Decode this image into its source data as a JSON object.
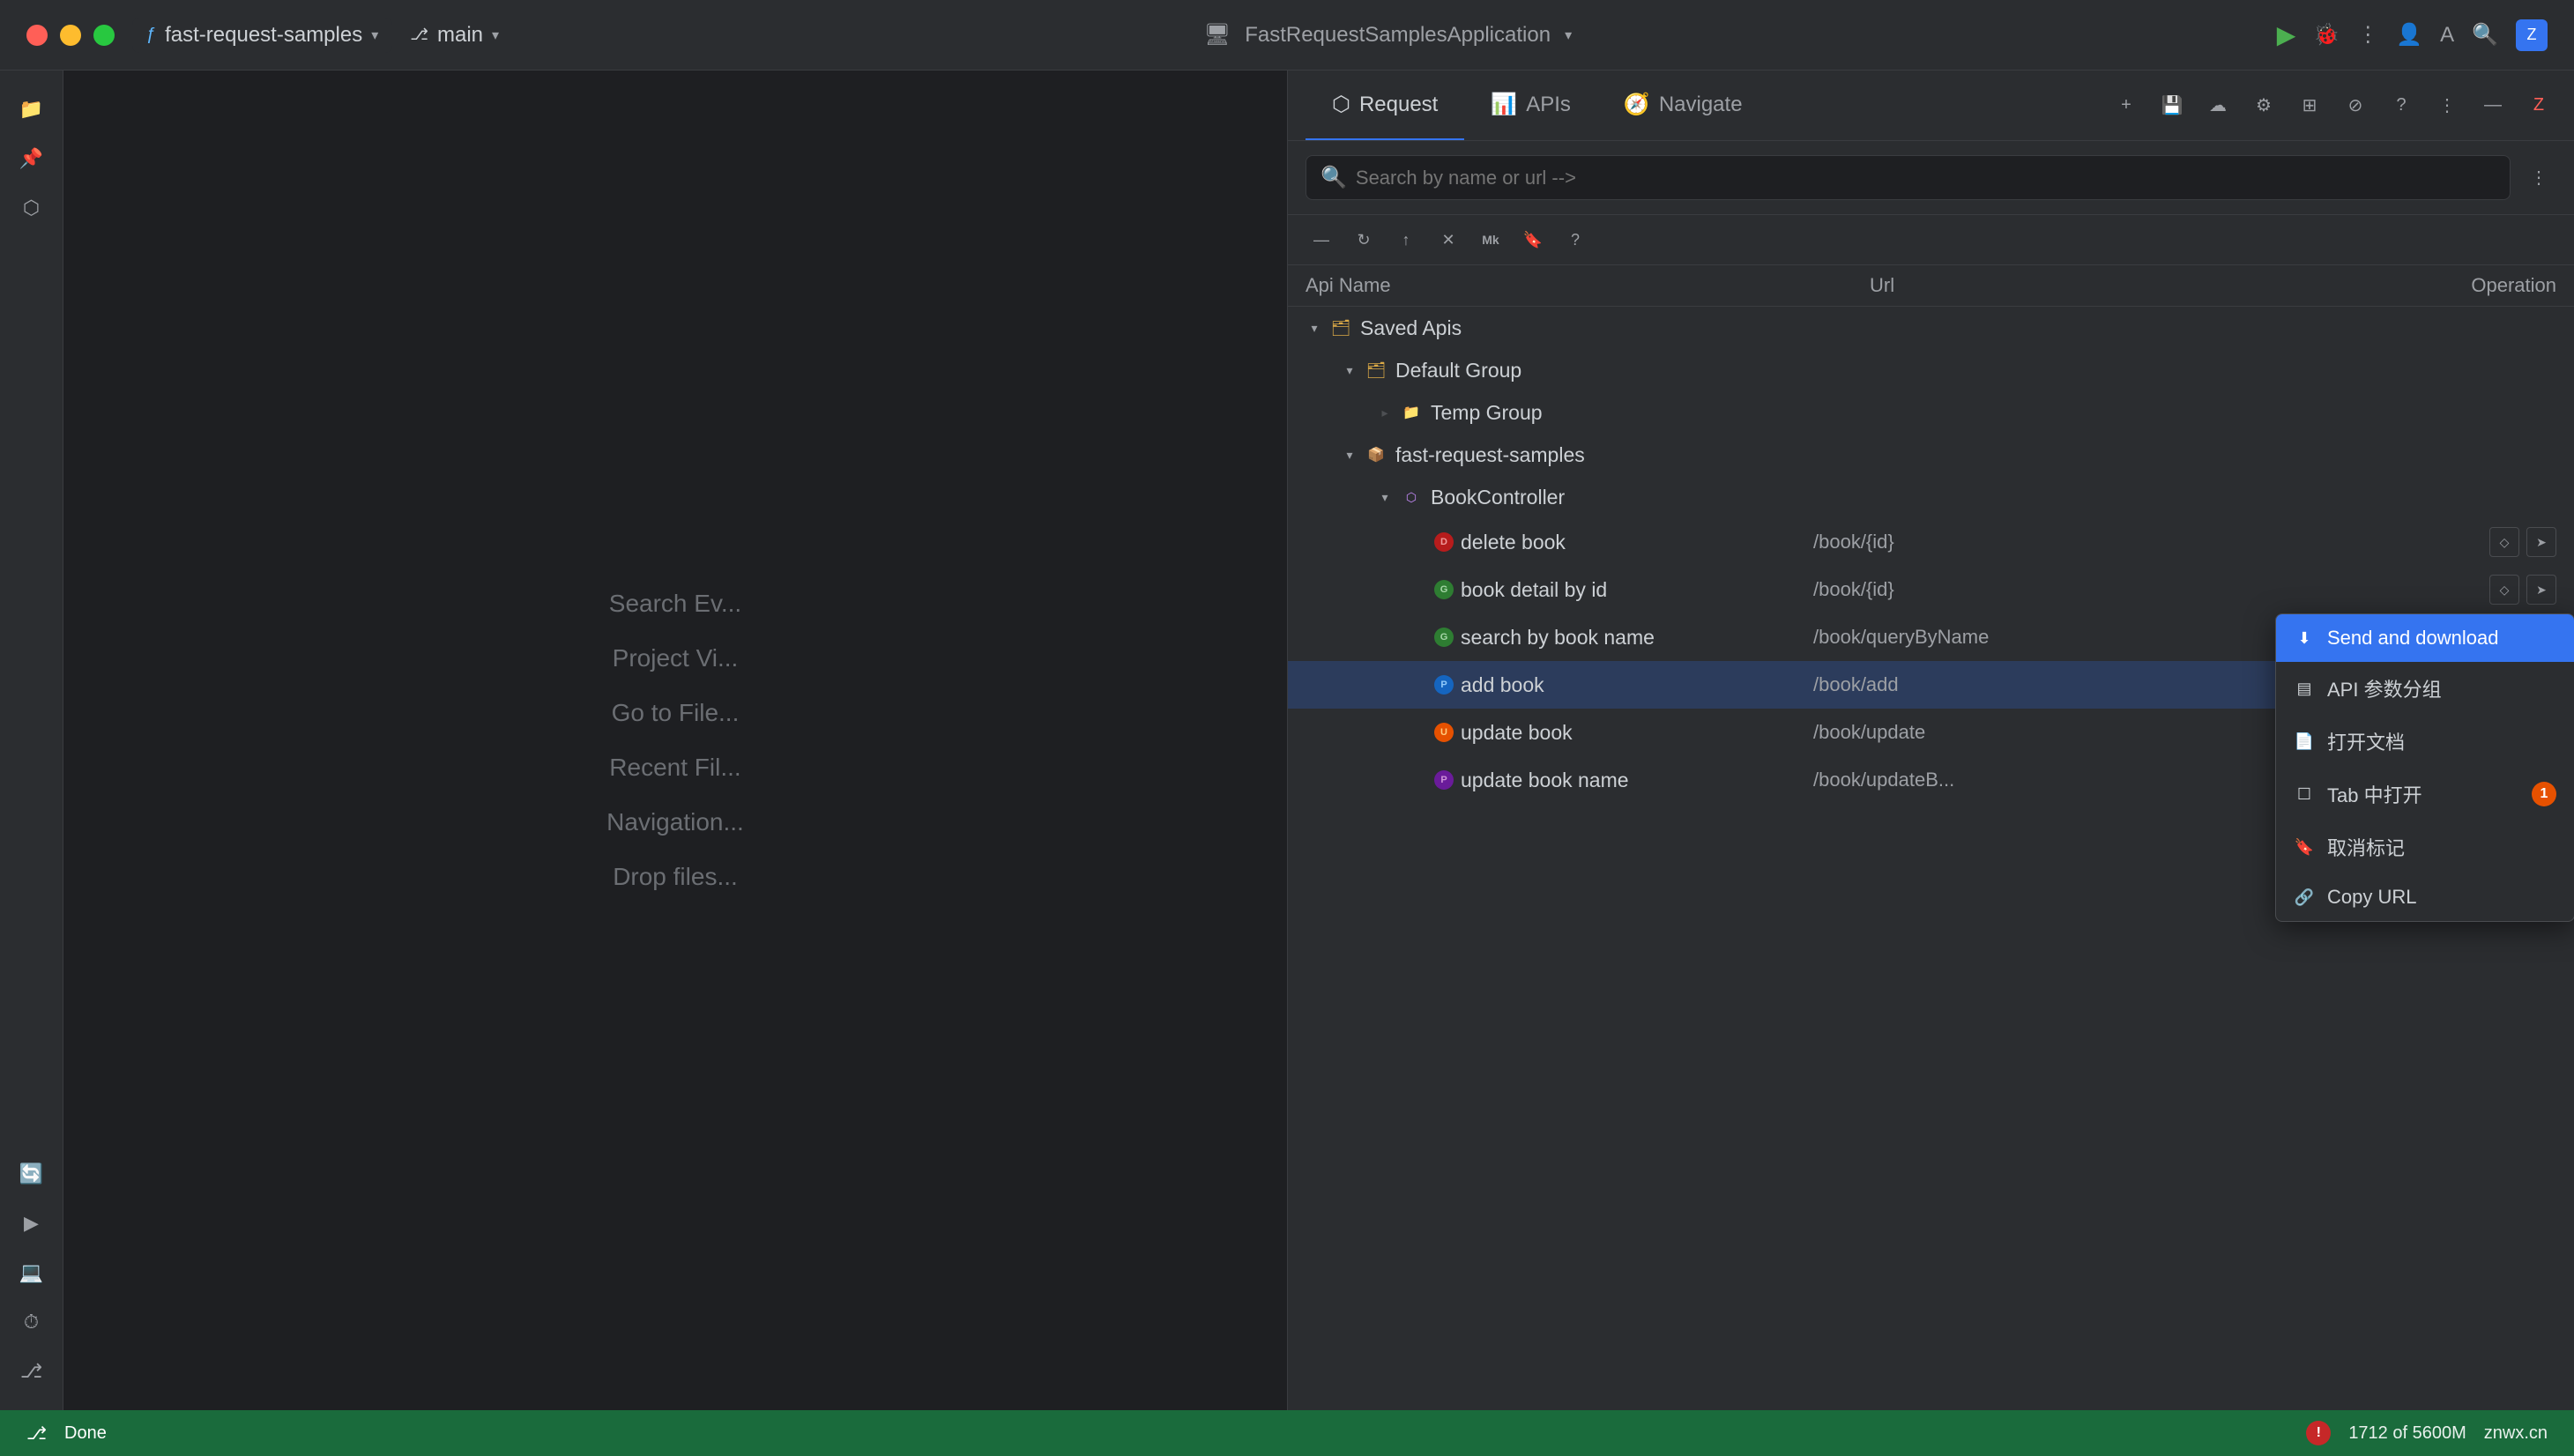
{
  "title_bar": {
    "project": "fast-request-samples",
    "branch": "main",
    "app_name": "FastRequestSamplesApplication",
    "traffic_lights": [
      "red",
      "yellow",
      "green"
    ]
  },
  "panel": {
    "tabs": [
      {
        "label": "Request",
        "icon": "⬡",
        "active": true
      },
      {
        "label": "APIs",
        "icon": "📊",
        "active": false
      },
      {
        "label": "Navigate",
        "icon": "🧭",
        "active": false
      }
    ],
    "search_placeholder": "Search by name or url -->",
    "toolbar_buttons": [
      "—",
      "↻",
      "↑",
      "✕",
      "Mk",
      "🔖",
      "?"
    ]
  },
  "table": {
    "columns": [
      "Api Name",
      "Url",
      "Operation"
    ]
  },
  "tree": {
    "items": [
      {
        "id": "saved-apis",
        "level": 0,
        "label": "Saved Apis",
        "type": "folder",
        "expanded": true
      },
      {
        "id": "default-group",
        "level": 1,
        "label": "Default Group",
        "type": "folder",
        "expanded": true
      },
      {
        "id": "temp-group",
        "level": 2,
        "label": "Temp Group",
        "type": "folder-sub",
        "expanded": false
      },
      {
        "id": "fast-request-samples",
        "level": 1,
        "label": "fast-request-samples",
        "type": "project",
        "expanded": true
      },
      {
        "id": "book-controller",
        "level": 2,
        "label": "BookController",
        "type": "controller",
        "expanded": true
      },
      {
        "id": "delete-book",
        "level": 3,
        "label": "delete book",
        "method": "DELETE",
        "url": "/book/{id}"
      },
      {
        "id": "book-detail-by-id",
        "level": 3,
        "label": "book detail by id",
        "method": "GET",
        "url": "/book/{id}"
      },
      {
        "id": "search-by-book-name",
        "level": 3,
        "label": "search by book name",
        "method": "GET",
        "url": "/book/queryByName"
      },
      {
        "id": "add-book",
        "level": 3,
        "label": "add book",
        "method": "POST",
        "url": "/book/add",
        "selected": true
      },
      {
        "id": "update-book",
        "level": 3,
        "label": "update book",
        "method": "PUT",
        "url": "/book/update"
      },
      {
        "id": "update-book-name",
        "level": 3,
        "label": "update book name",
        "method": "PATCH",
        "url": "/book/updateB..."
      }
    ]
  },
  "context_menu": {
    "items": [
      {
        "id": "send-download",
        "label": "Send and download",
        "icon": "⬇",
        "highlighted": true
      },
      {
        "id": "api-params-group",
        "label": "API 参数分组",
        "icon": "▤"
      },
      {
        "id": "open-doc",
        "label": "打开文档",
        "icon": "📄"
      },
      {
        "id": "open-tab",
        "label": "Tab 中打开",
        "icon": "☐",
        "badge": "1"
      },
      {
        "id": "cancel-mark",
        "label": "取消标记",
        "icon": "🔖"
      },
      {
        "id": "copy-url",
        "label": "Copy URL",
        "icon": "🔗"
      }
    ]
  },
  "status_bar": {
    "status": "Done",
    "position": "1712 of 5600M",
    "suffix": "znwx.cn"
  },
  "editor_items": [
    "Search Ev...",
    "Project Vi...",
    "Go to File...",
    "Recent Fil...",
    "Navigation...",
    "Drop files..."
  ]
}
